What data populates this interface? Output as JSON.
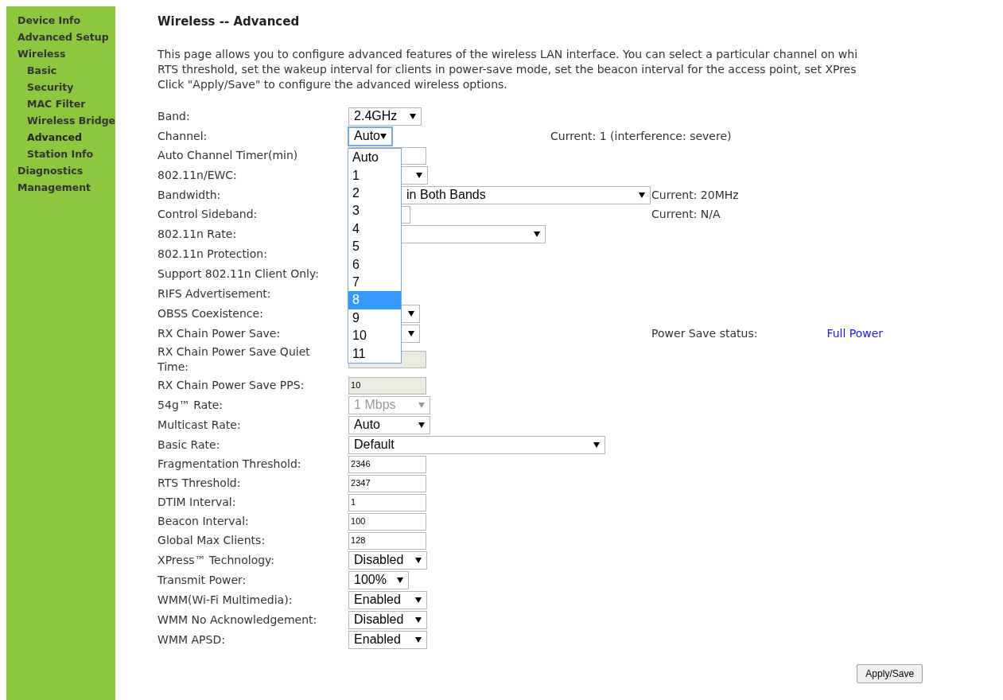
{
  "sidebar": {
    "items": [
      {
        "label": "Device Info",
        "selected": false
      },
      {
        "label": "Advanced Setup",
        "selected": false
      },
      {
        "label": "Wireless",
        "selected": false,
        "children": [
          {
            "label": "Basic",
            "selected": false
          },
          {
            "label": "Security",
            "selected": false
          },
          {
            "label": "MAC Filter",
            "selected": false
          },
          {
            "label": "Wireless Bridge",
            "selected": false
          },
          {
            "label": "Advanced",
            "selected": true
          },
          {
            "label": "Station Info",
            "selected": false
          }
        ]
      },
      {
        "label": "Diagnostics",
        "selected": false
      },
      {
        "label": "Management",
        "selected": false
      }
    ]
  },
  "title": "Wireless -- Advanced",
  "description": [
    "This page allows you to configure advanced features of the wireless LAN interface. You can select a particular channel on whi",
    "RTS threshold, set the wakeup interval for clients in power-save mode, set the beacon interval for the access point, set XPres",
    "Click \"Apply/Save\" to configure the advanced wireless options."
  ],
  "rows": [
    {
      "label": "Band:",
      "control": {
        "kind": "select",
        "value": "2.4GHz",
        "disabled": false
      }
    },
    {
      "label": "Channel:",
      "control": {
        "kind": "select",
        "value": "Auto",
        "disabled": false,
        "open": true
      },
      "note": {
        "kind": "near",
        "text": "Current: 1 (interference: severe)"
      }
    },
    {
      "label": "Auto Channel Timer(min)",
      "control": {
        "kind": "input",
        "disabled": false
      }
    },
    {
      "label": "802.11n/EWC:",
      "control": {
        "kind": "select",
        "disabled": false
      }
    },
    {
      "label": "Bandwidth:",
      "control": {
        "kind": "select_covered",
        "value": "in Both Bands",
        "disabled": false
      },
      "note": {
        "kind": "column",
        "text": "Current: 20MHz"
      }
    },
    {
      "label": "Control Sideband:",
      "control": {
        "kind": "input",
        "disabled": false
      },
      "note": {
        "kind": "column",
        "text": "Current: N/A"
      }
    },
    {
      "label": "802.11n Rate:",
      "control": {
        "kind": "select",
        "disabled": false
      }
    },
    {
      "label": "802.11n Protection:",
      "control": {
        "kind": "none"
      }
    },
    {
      "label": "Support 802.11n Client Only:",
      "control": {
        "kind": "none"
      }
    },
    {
      "label": "RIFS Advertisement:",
      "control": {
        "kind": "none"
      }
    },
    {
      "label": "OBSS Coexistence:",
      "control": {
        "kind": "select",
        "disabled": false
      }
    },
    {
      "label": "RX Chain Power Save:",
      "control": {
        "kind": "select",
        "disabled": false
      },
      "note": {
        "kind": "column",
        "text": "Power Save status:",
        "status": "Full Power"
      }
    },
    {
      "label": "RX Chain Power Save Quiet Time:",
      "control": {
        "kind": "input",
        "disabled": true
      }
    },
    {
      "label": "RX Chain Power Save PPS:",
      "control": {
        "kind": "input",
        "value": "10",
        "disabled": true
      }
    },
    {
      "label": "54g™ Rate:",
      "control": {
        "kind": "select",
        "value": "1 Mbps",
        "disabled": true
      }
    },
    {
      "label": "Multicast Rate:",
      "control": {
        "kind": "select",
        "value": "Auto",
        "disabled": false
      }
    },
    {
      "label": "Basic Rate:",
      "control": {
        "kind": "select",
        "value": "Default",
        "disabled": false
      }
    },
    {
      "label": "Fragmentation Threshold:",
      "control": {
        "kind": "input",
        "value": "2346",
        "disabled": false
      }
    },
    {
      "label": "RTS Threshold:",
      "control": {
        "kind": "input",
        "value": "2347",
        "disabled": false
      }
    },
    {
      "label": "DTIM Interval:",
      "control": {
        "kind": "input",
        "value": "1",
        "disabled": false
      }
    },
    {
      "label": "Beacon Interval:",
      "control": {
        "kind": "input",
        "value": "100",
        "disabled": false
      }
    },
    {
      "label": "Global Max Clients:",
      "control": {
        "kind": "input",
        "value": "128",
        "disabled": false
      }
    },
    {
      "label": "XPress™ Technology:",
      "control": {
        "kind": "select",
        "value": "Disabled",
        "disabled": false
      }
    },
    {
      "label": "Transmit Power:",
      "control": {
        "kind": "select",
        "value": "100%",
        "disabled": false
      }
    },
    {
      "label": "WMM(Wi-Fi Multimedia):",
      "control": {
        "kind": "select",
        "value": "Enabled",
        "disabled": false
      }
    },
    {
      "label": "WMM No Acknowledgement:",
      "control": {
        "kind": "select",
        "value": "Disabled",
        "disabled": false
      }
    },
    {
      "label": "WMM APSD:",
      "control": {
        "kind": "select",
        "value": "Enabled",
        "disabled": false
      }
    }
  ],
  "channel_options": [
    {
      "label": "Auto",
      "selected": false
    },
    {
      "label": "1",
      "selected": false
    },
    {
      "label": "2",
      "selected": false
    },
    {
      "label": "3",
      "selected": false
    },
    {
      "label": "4",
      "selected": false
    },
    {
      "label": "5",
      "selected": false
    },
    {
      "label": "6",
      "selected": false
    },
    {
      "label": "7",
      "selected": false
    },
    {
      "label": "8",
      "selected": true
    },
    {
      "label": "9",
      "selected": false
    },
    {
      "label": "10",
      "selected": false
    },
    {
      "label": "11",
      "selected": false
    }
  ],
  "apply_button": "Apply/Save"
}
